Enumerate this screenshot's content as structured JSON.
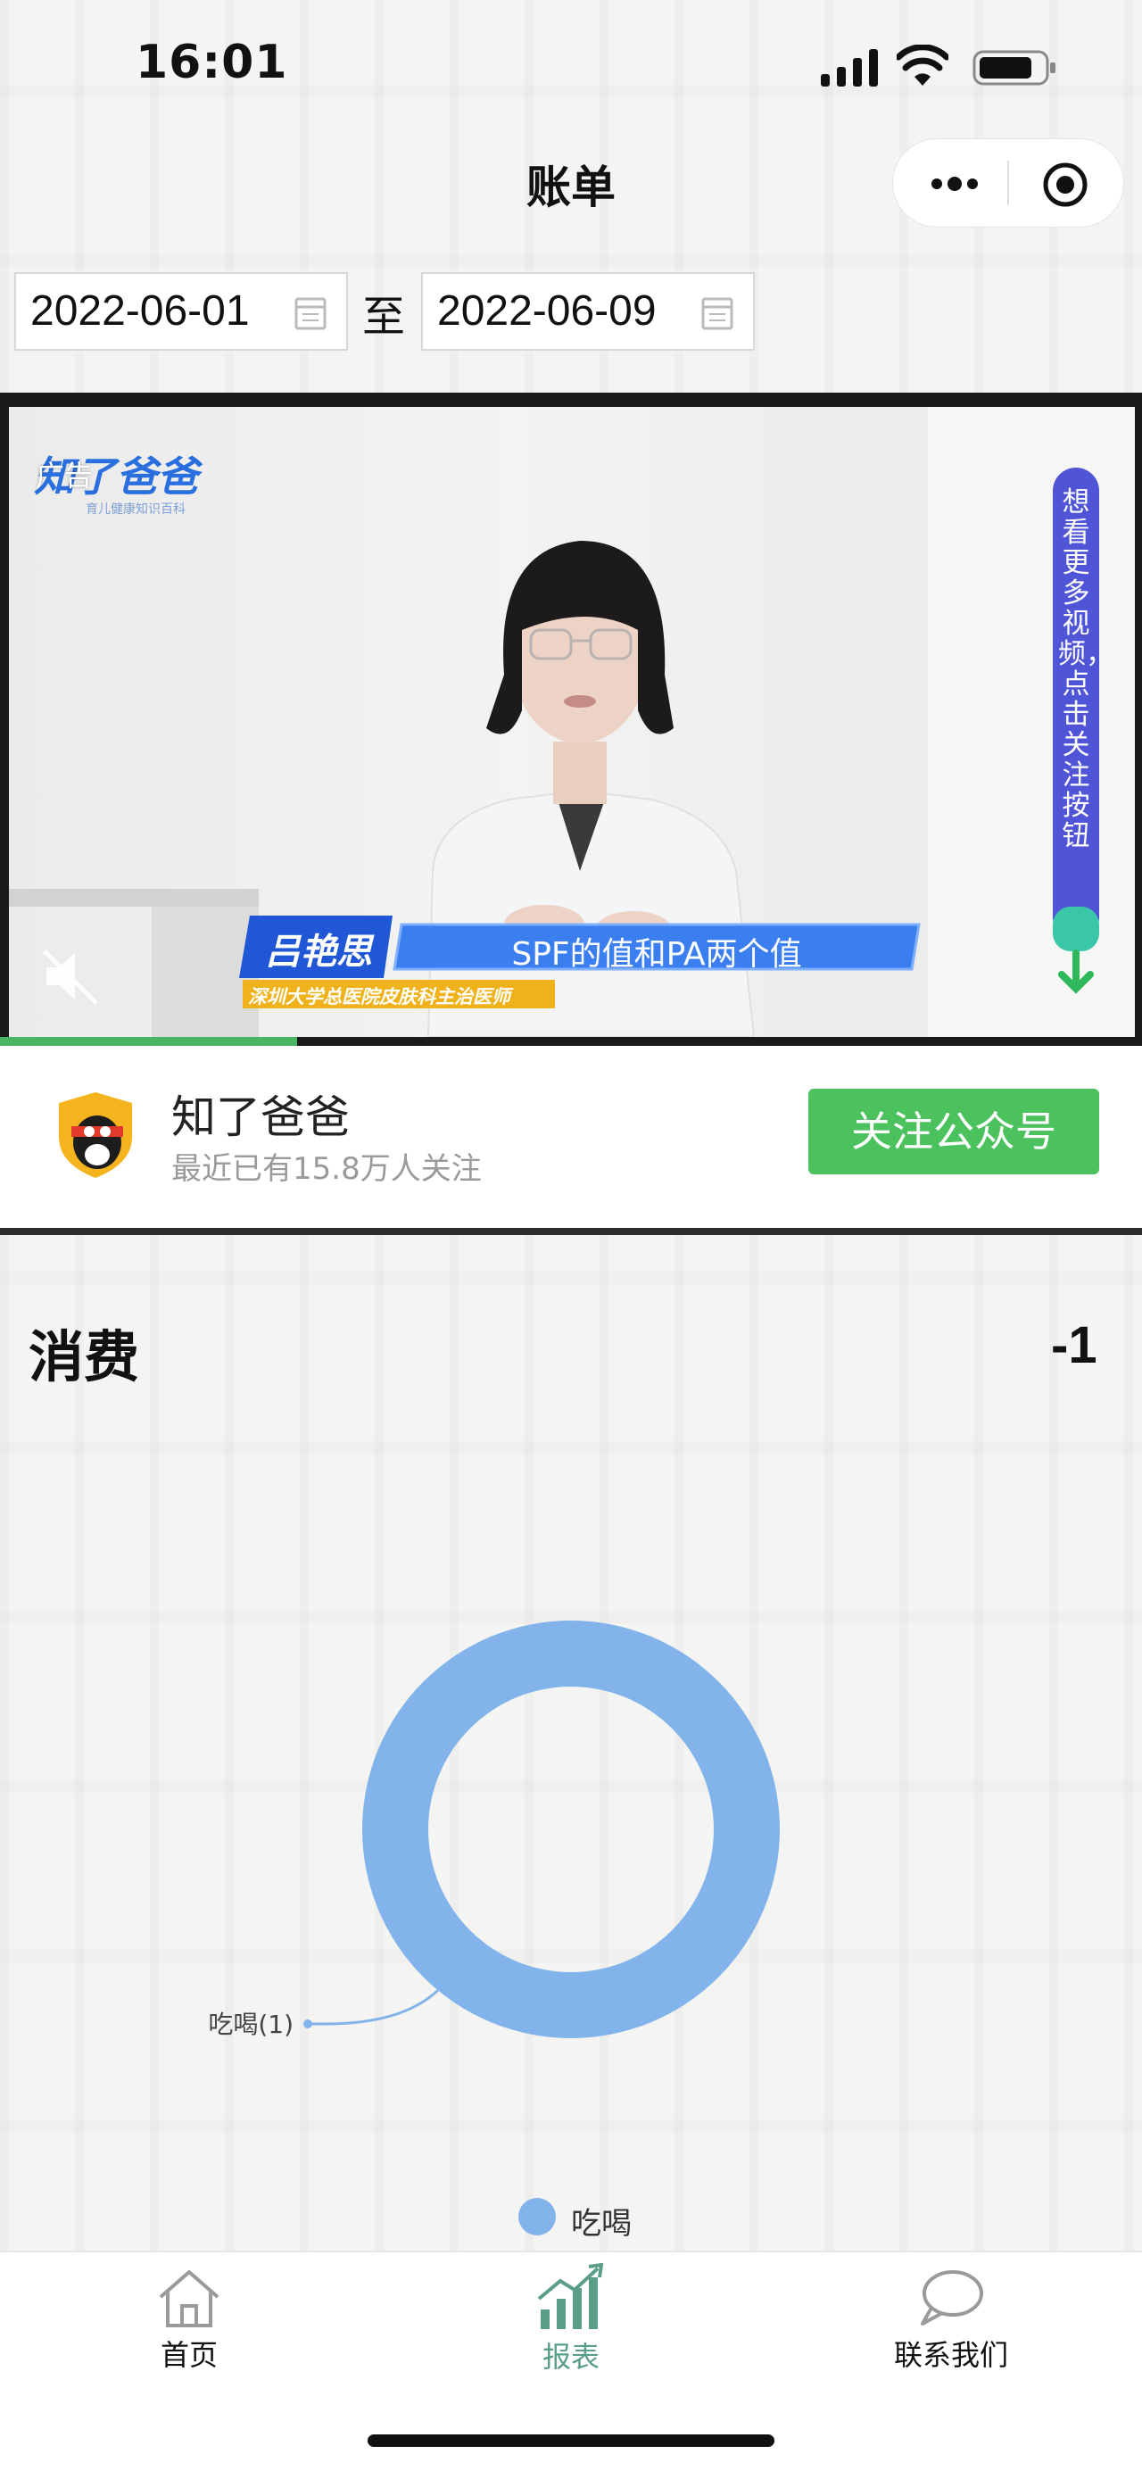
{
  "status_bar": {
    "time": "16:01"
  },
  "nav": {
    "title": "账单",
    "capsule_more_icon": "more-dots-icon",
    "capsule_close_icon": "target-circle-icon"
  },
  "date_range": {
    "start": "2022-06-01",
    "separator": "至",
    "end": "2022-06-09"
  },
  "ad": {
    "tag": "广告",
    "brand": "知了爸爸",
    "brand_sub": "育儿健康知识百科",
    "side_banner": "想看更多视频，点击关注按钮",
    "presenter_name": "吕艳思",
    "presenter_title": "深圳大学总医院皮肤科主治医师",
    "caption": "SPF的值和PA两个值",
    "progress": 0.26,
    "account_name": "知了爸爸",
    "account_followers": "最近已有15.8万人关注",
    "follow_button": "关注公众号"
  },
  "section": {
    "title": "消费",
    "total": "-1"
  },
  "chart_data": {
    "type": "pie",
    "categories": [
      "吃喝"
    ],
    "values": [
      1
    ],
    "labels": [
      "吃喝(1)"
    ],
    "colors": [
      "#82b3ea"
    ],
    "donut": true,
    "legend": "bottom-center"
  },
  "legend": {
    "label": "吃喝"
  },
  "tabs": [
    {
      "label": "首页",
      "icon": "home-icon",
      "active": false
    },
    {
      "label": "报表",
      "icon": "chart-icon",
      "active": true
    },
    {
      "label": "联系我们",
      "icon": "chat-bubble-icon",
      "active": false
    }
  ],
  "colors": {
    "accent": "#4cc25e",
    "active_tab": "#5a9f85",
    "chart": "#82b3ea"
  }
}
